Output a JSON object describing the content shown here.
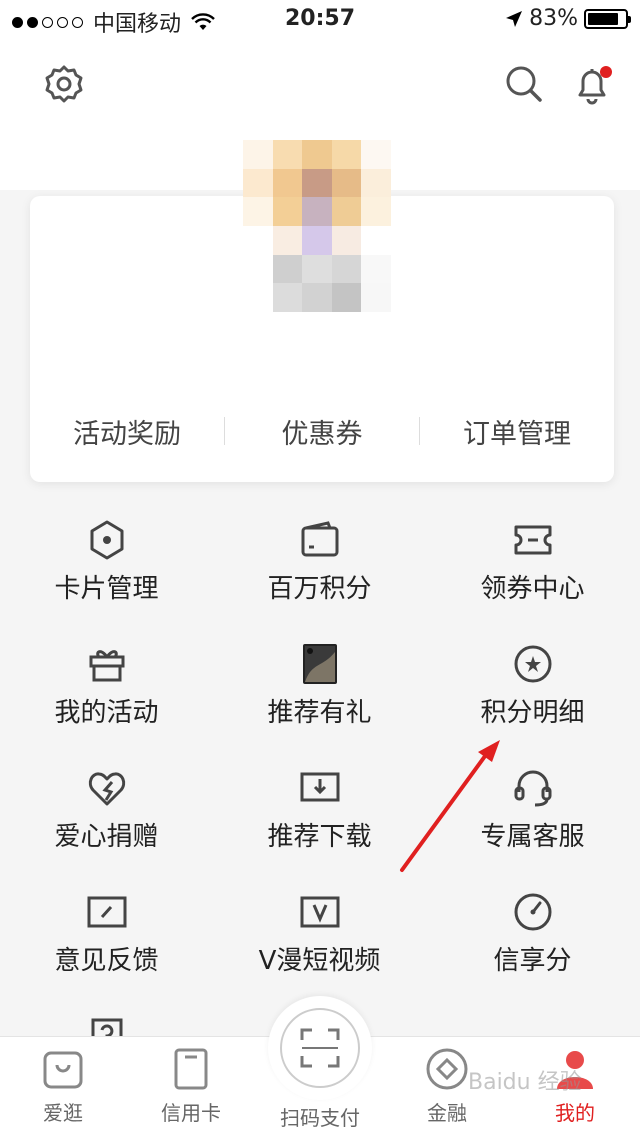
{
  "status_bar": {
    "carrier": "中国移动",
    "time": "20:57",
    "battery": "83%",
    "battery_level": 0.83
  },
  "header": {
    "icons": [
      "gear-icon",
      "search-icon",
      "bell-icon"
    ],
    "notification": true
  },
  "profile": {
    "links": [
      "活动奖励",
      "优惠券",
      "订单管理"
    ]
  },
  "menu": [
    {
      "label": "卡片管理",
      "icon": "hexagon-icon"
    },
    {
      "label": "百万积分",
      "icon": "wallet-icon"
    },
    {
      "label": "领券中心",
      "icon": "ticket-icon"
    },
    {
      "label": "我的活动",
      "icon": "gift-icon"
    },
    {
      "label": "推荐有礼",
      "icon": "phone-image-icon"
    },
    {
      "label": "积分明细",
      "icon": "star-circle-icon"
    },
    {
      "label": "爱心捐赠",
      "icon": "heart-icon"
    },
    {
      "label": "推荐下载",
      "icon": "download-icon"
    },
    {
      "label": "专属客服",
      "icon": "headset-icon"
    },
    {
      "label": "意见反馈",
      "icon": "edit-icon"
    },
    {
      "label": "V漫短视频",
      "icon": "v-icon"
    },
    {
      "label": "信享分",
      "icon": "gauge-icon"
    },
    {
      "label": "",
      "icon": "help-icon"
    }
  ],
  "tabbar": {
    "items": [
      {
        "label": "爱逛",
        "icon": "bag-icon"
      },
      {
        "label": "信用卡",
        "icon": "card-icon"
      },
      {
        "label": "扫码支付",
        "icon": "scan-icon"
      },
      {
        "label": "金融",
        "icon": "diamond-icon"
      },
      {
        "label": "我的",
        "icon": "user-icon"
      }
    ],
    "active": "我的"
  },
  "watermark": "Baidu 经验"
}
